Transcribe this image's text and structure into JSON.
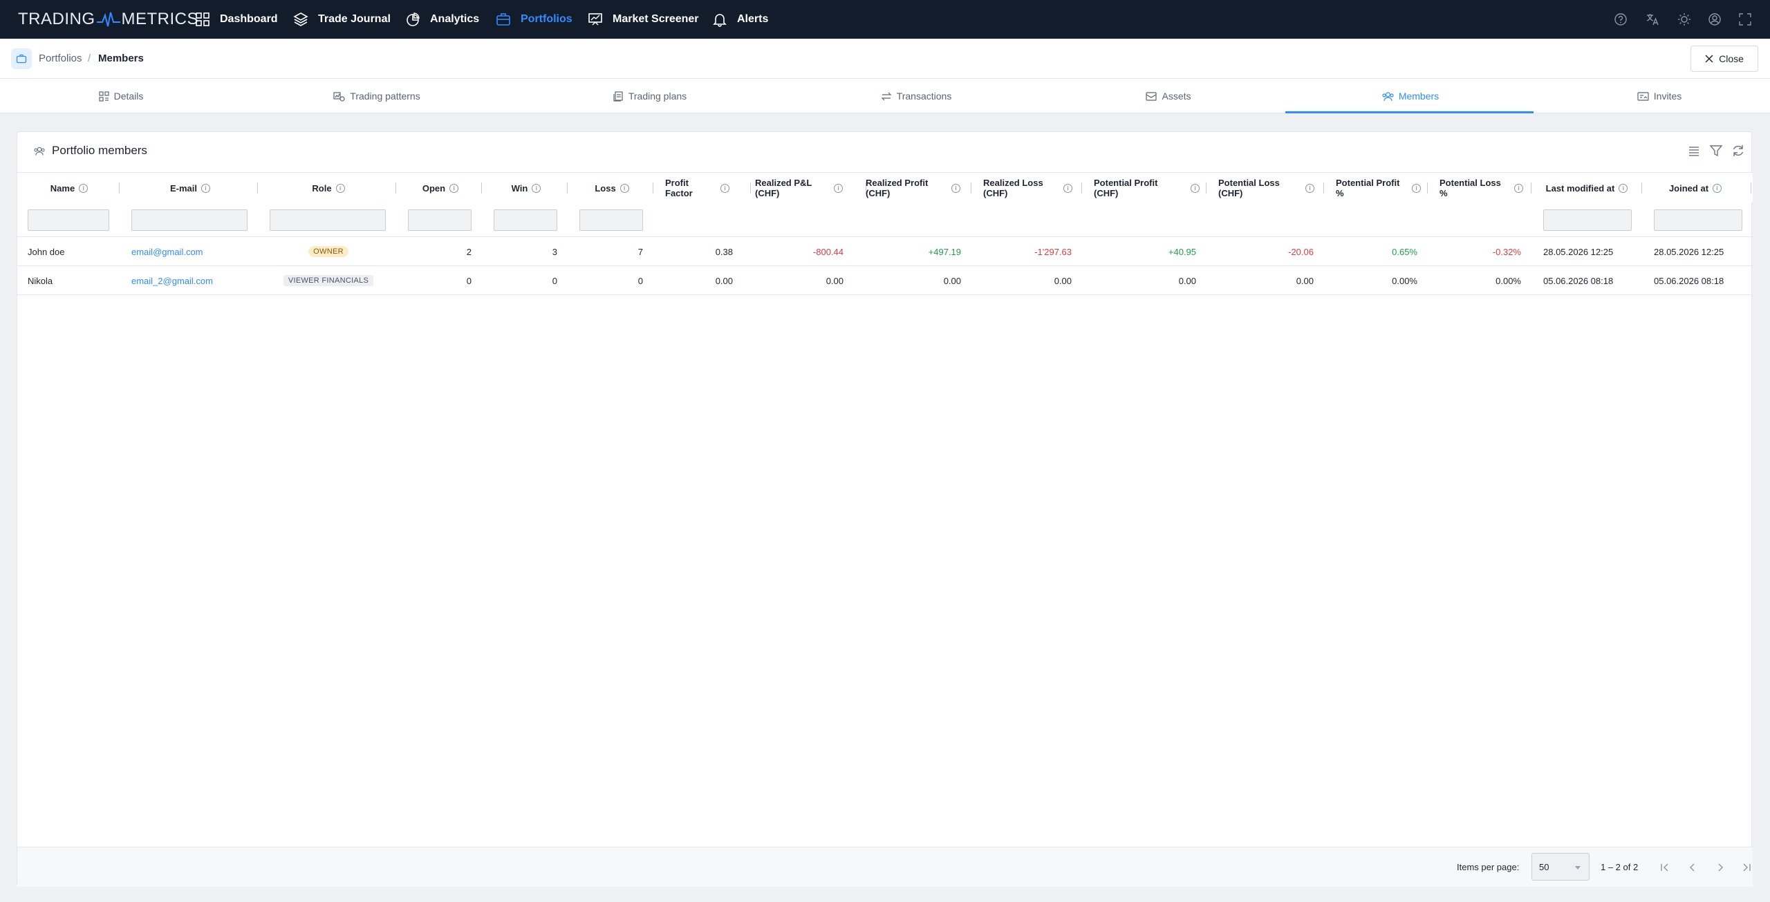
{
  "app": {
    "logo_left": "TRADING",
    "logo_right": "METRICS"
  },
  "nav": {
    "items": [
      {
        "label": "Dashboard",
        "icon": "grid-icon"
      },
      {
        "label": "Trade Journal",
        "icon": "layers-icon"
      },
      {
        "label": "Analytics",
        "icon": "pie-chart-icon"
      },
      {
        "label": "Portfolios",
        "icon": "briefcase-icon",
        "active": true
      },
      {
        "label": "Market Screener",
        "icon": "presentation-chart-icon"
      },
      {
        "label": "Alerts",
        "icon": "bell-icon"
      }
    ],
    "right_icons": [
      "help-icon",
      "translate-icon",
      "theme-sun-icon",
      "account-icon",
      "fullscreen-icon"
    ]
  },
  "breadcrumb": {
    "parent": "Portfolios",
    "separator": "/",
    "current": "Members"
  },
  "close_label": "Close",
  "tabs": [
    {
      "label": "Details",
      "icon": "details-icon"
    },
    {
      "label": "Trading patterns",
      "icon": "patterns-icon"
    },
    {
      "label": "Trading plans",
      "icon": "plans-icon"
    },
    {
      "label": "Transactions",
      "icon": "transactions-icon"
    },
    {
      "label": "Assets",
      "icon": "assets-icon"
    },
    {
      "label": "Members",
      "icon": "members-icon",
      "active": true
    },
    {
      "label": "Invites",
      "icon": "invites-icon"
    }
  ],
  "table": {
    "title": "Portfolio members",
    "tools": [
      "columns-icon",
      "filter-icon",
      "refresh-icon"
    ],
    "columns": [
      {
        "l1": "Name",
        "l2": ""
      },
      {
        "l1": "E-mail",
        "l2": ""
      },
      {
        "l1": "Role",
        "l2": ""
      },
      {
        "l1": "Open",
        "l2": ""
      },
      {
        "l1": "Win",
        "l2": ""
      },
      {
        "l1": "Loss",
        "l2": ""
      },
      {
        "l1": "Profit",
        "l2": "Factor"
      },
      {
        "l1": "Realized P&L",
        "l2": "(CHF)"
      },
      {
        "l1": "Realized Profit",
        "l2": "(CHF)"
      },
      {
        "l1": "Realized Loss",
        "l2": "(CHF)"
      },
      {
        "l1": "Potential Profit",
        "l2": "(CHF)"
      },
      {
        "l1": "Potential Loss",
        "l2": "(CHF)"
      },
      {
        "l1": "Potential Profit",
        "l2": "%"
      },
      {
        "l1": "Potential Loss",
        "l2": "%"
      },
      {
        "l1": "Last modified at",
        "l2": ""
      },
      {
        "l1": "Joined at",
        "l2": ""
      }
    ],
    "rows": [
      {
        "name": "John doe",
        "email": "email@gmail.com",
        "role": "OWNER",
        "open": "2",
        "win": "3",
        "loss": "7",
        "profit_factor": "0.38",
        "realized_pnl": "-800.44",
        "realized_profit": "+497.19",
        "realized_loss": "-1'297.63",
        "potential_profit": "+40.95",
        "potential_loss": "-20.06",
        "potential_profit_pct": "0.65%",
        "potential_loss_pct": "-0.32%",
        "last_modified": "28.05.2026 12:25",
        "joined": "28.05.2026 12:25"
      },
      {
        "name": "Nikola",
        "email": "email_2@gmail.com",
        "role": "VIEWER FINANCIALS",
        "open": "0",
        "win": "0",
        "loss": "0",
        "profit_factor": "0.00",
        "realized_pnl": "0.00",
        "realized_profit": "0.00",
        "realized_loss": "0.00",
        "potential_profit": "0.00",
        "potential_loss": "0.00",
        "potential_profit_pct": "0.00%",
        "potential_loss_pct": "0.00%",
        "last_modified": "05.06.2026 08:18",
        "joined": "05.06.2026 08:18"
      }
    ]
  },
  "paginator": {
    "items_per_page_label": "Items per page:",
    "items_per_page": "50",
    "range": "1 – 2 of 2"
  },
  "colors": {
    "nav_bg": "#131c2b",
    "accent": "#2f8cff",
    "positive": "#1f9d4d",
    "negative": "#e03b3b"
  }
}
